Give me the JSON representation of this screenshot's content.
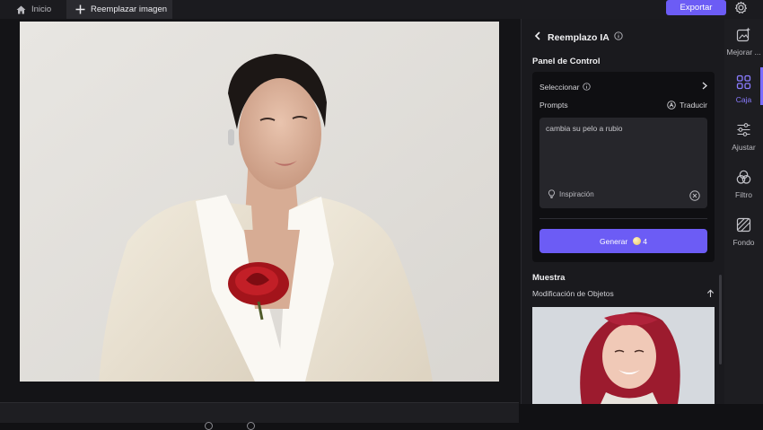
{
  "topbar": {
    "home_label": "Inicio",
    "active_tab_label": "Reemplazar imagen",
    "export_label": "Exportar"
  },
  "panel": {
    "title": "Reemplazo IA",
    "control_title": "Panel de Control",
    "select_label": "Seleccionar",
    "prompts_label": "Prompts",
    "translate_label": "Traducir",
    "prompt_value": "cambia su pelo a rubio",
    "inspiration_label": "Inspiración",
    "generate_label": "Generar",
    "generate_cost": "4",
    "sample_title": "Muestra",
    "sample_subtitle": "Modificación de Objetos"
  },
  "tools": [
    {
      "label": "Mejorar ...",
      "icon": "enhance-icon"
    },
    {
      "label": "Caja",
      "icon": "grid-icon"
    },
    {
      "label": "Ajustar",
      "icon": "sliders-icon"
    },
    {
      "label": "Filtro",
      "icon": "filter-icon"
    },
    {
      "label": "Fondo",
      "icon": "background-icon"
    }
  ],
  "colors": {
    "accent": "#6c5cf5",
    "active_tool": "#8a7cff",
    "panel_bg": "#1a1a1e"
  }
}
